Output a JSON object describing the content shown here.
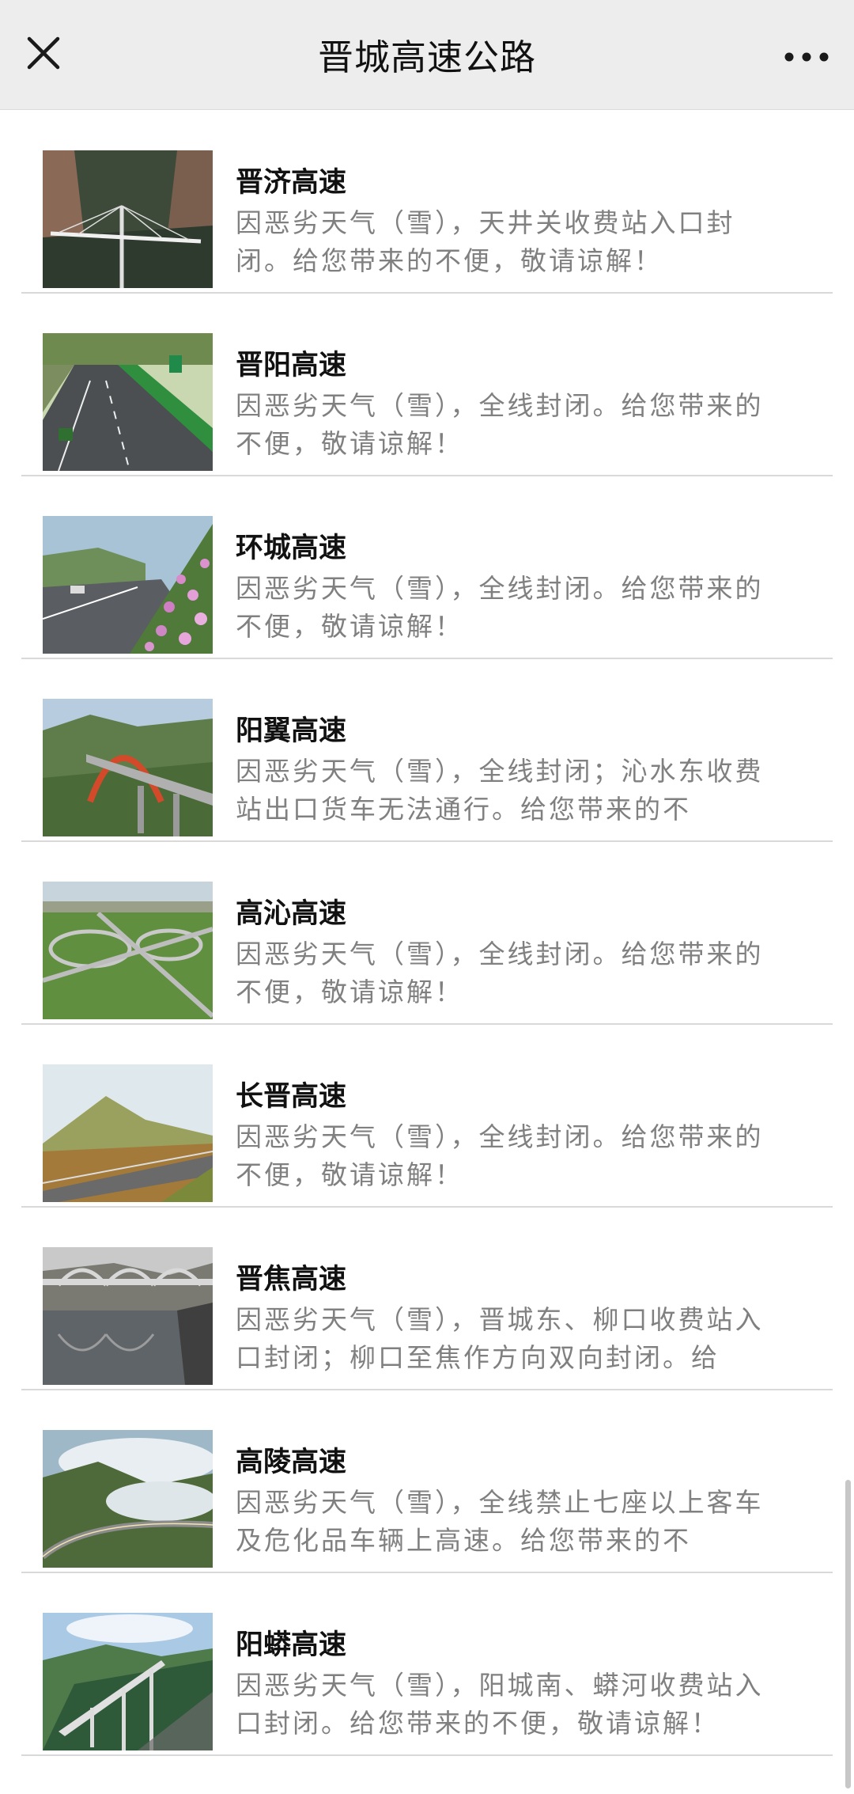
{
  "navbar": {
    "title": "晋城高速公路",
    "close_icon": "close-icon",
    "more_icon": "more-icon"
  },
  "items": [
    {
      "title": "晋济高速",
      "desc": "因恶劣天气（雪），天井关收费站入口封闭。给您带来的不便，敬请谅解！",
      "image": "cable-stayed-bridge-canyon"
    },
    {
      "title": "晋阳高速",
      "desc": "因恶劣天气（雪），全线封闭。给您带来的不便，敬请谅解！",
      "image": "highway-green-road-signs"
    },
    {
      "title": "环城高速",
      "desc": "因恶劣天气（雪），全线封闭。给您带来的不便，敬请谅解！",
      "image": "highway-with-pink-flowers"
    },
    {
      "title": "阳翼高速",
      "desc": "因恶劣天气（雪），全线封闭；沁水东收费站出口货车无法通行。给您带来的不",
      "image": "red-arch-bridge"
    },
    {
      "title": "高沁高速",
      "desc": "因恶劣天气（雪），全线封闭。给您带来的不便，敬请谅解！",
      "image": "interchange-aerial"
    },
    {
      "title": "长晋高速",
      "desc": "因恶劣天气（雪），全线封闭。给您带来的不便，敬请谅解！",
      "image": "highway-hillside"
    },
    {
      "title": "晋焦高速",
      "desc": "因恶劣天气（雪），晋城东、柳口收费站入口封闭；柳口至焦作方向双向封闭。给",
      "image": "arch-bridge-river"
    },
    {
      "title": "高陵高速",
      "desc": "因恶劣天气（雪），全线禁止七座以上客车及危化品车辆上高速。给您带来的不",
      "image": "misty-mountain-road"
    },
    {
      "title": "阳蟒高速",
      "desc": "因恶劣天气（雪），阳城南、蟒河收费站入口封闭。给您带来的不便，敬请谅解！",
      "image": "viaduct-valley"
    }
  ]
}
